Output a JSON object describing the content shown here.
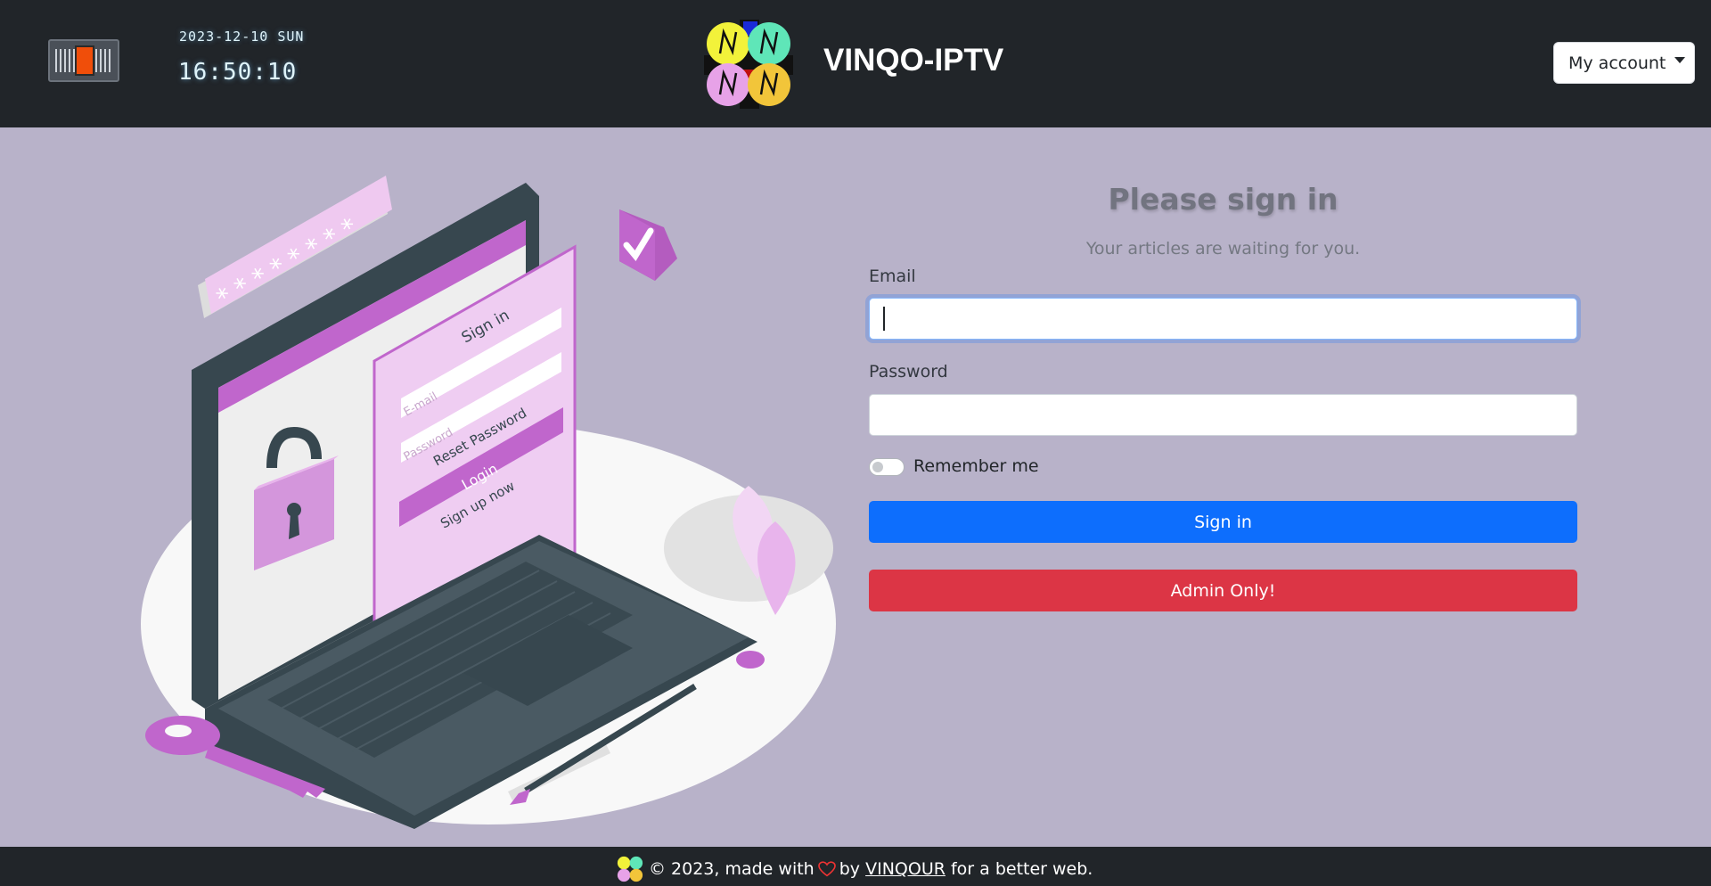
{
  "header": {
    "date": "2023-12-10 SUN",
    "time": "16:50:10",
    "site_title": "VINQO-IPTV",
    "account_label": "My account"
  },
  "form": {
    "title": "Please sign in",
    "subtitle": "Your articles are waiting for you.",
    "email_label": "Email",
    "email_value": "",
    "password_label": "Password",
    "password_value": "",
    "remember_label": "Remember me",
    "signin_label": "Sign in",
    "admin_label": "Admin Only!"
  },
  "illustration": {
    "password_mask": "* * * * * * * *",
    "card_title": "Sign in",
    "email_placeholder": "E-mail",
    "password_placeholder": "Password",
    "reset_label": "Reset Password",
    "login_label": "Login",
    "signup_label": "Sign up now"
  },
  "footer": {
    "prefix": "© 2023, made with",
    "by": "by",
    "author": "VINQOUR",
    "suffix": "for a better web."
  },
  "colors": {
    "header_bg": "#212529",
    "page_bg": "#b8b2c9",
    "primary": "#0d6efd",
    "danger": "#dc3545",
    "accent_purple": "#c066cc"
  },
  "icons": {
    "logo": "vinqo-logo-icon",
    "heart": "heart-icon",
    "account_caret": "caret-down-icon"
  }
}
